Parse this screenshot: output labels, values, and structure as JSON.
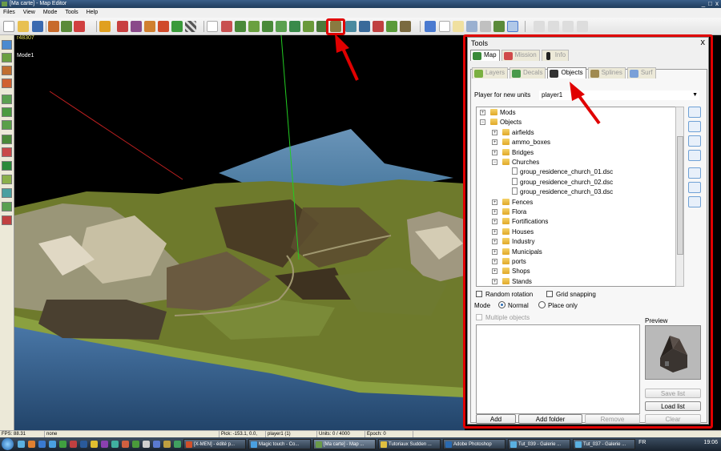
{
  "window": {
    "title": "[Ma carte] - Map Editor",
    "controls": [
      "_",
      "□",
      "x"
    ]
  },
  "menu": [
    "Files",
    "View",
    "Mode",
    "Tools",
    "Help"
  ],
  "viewport": {
    "label_top": "r48307",
    "label_mode": "Mode1"
  },
  "tools_panel": {
    "title": "Tools",
    "close": "x",
    "tabs_top": [
      {
        "label": "Map",
        "active": true,
        "icon": "map-icon"
      },
      {
        "label": "Mission",
        "active": false,
        "icon": "mission-icon"
      },
      {
        "label": "Info",
        "active": false,
        "icon": "info-icon"
      }
    ],
    "tabs_sub": [
      {
        "label": "Layers",
        "active": false,
        "icon": "layers-icon"
      },
      {
        "label": "Decals",
        "active": false,
        "icon": "decals-icon"
      },
      {
        "label": "Objects",
        "active": true,
        "icon": "objects-icon"
      },
      {
        "label": "Splines",
        "active": false,
        "icon": "splines-icon"
      },
      {
        "label": "Surf",
        "active": false,
        "icon": "surf-icon"
      }
    ],
    "player_label": "Player for new units",
    "player_value": "player1",
    "tree": [
      {
        "label": "Mods",
        "level": 0,
        "type": "folder",
        "expanded": false
      },
      {
        "label": "Objects",
        "level": 0,
        "type": "folder",
        "expanded": true
      },
      {
        "label": "airfields",
        "level": 1,
        "type": "folder",
        "expanded": false
      },
      {
        "label": "ammo_boxes",
        "level": 1,
        "type": "folder",
        "expanded": false
      },
      {
        "label": "Bridges",
        "level": 1,
        "type": "folder",
        "expanded": false
      },
      {
        "label": "Churches",
        "level": 1,
        "type": "folder",
        "expanded": true
      },
      {
        "label": "group_residence_church_01.dsc",
        "level": 2,
        "type": "file"
      },
      {
        "label": "group_residence_church_02.dsc",
        "level": 2,
        "type": "file"
      },
      {
        "label": "group_residence_church_03.dsc",
        "level": 2,
        "type": "file"
      },
      {
        "label": "Fences",
        "level": 1,
        "type": "folder",
        "expanded": false
      },
      {
        "label": "Flora",
        "level": 1,
        "type": "folder",
        "expanded": false
      },
      {
        "label": "Fortifications",
        "level": 1,
        "type": "folder",
        "expanded": false
      },
      {
        "label": "Houses",
        "level": 1,
        "type": "folder",
        "expanded": false
      },
      {
        "label": "Industry",
        "level": 1,
        "type": "folder",
        "expanded": false
      },
      {
        "label": "Municipals",
        "level": 1,
        "type": "folder",
        "expanded": false
      },
      {
        "label": "ports",
        "level": 1,
        "type": "folder",
        "expanded": false
      },
      {
        "label": "Shops",
        "level": 1,
        "type": "folder",
        "expanded": false
      },
      {
        "label": "Stands",
        "level": 1,
        "type": "folder",
        "expanded": false
      }
    ],
    "random_rotation": "Random rotation",
    "grid_snapping": "Grid snapping",
    "mode_label": "Mode",
    "mode_normal": "Normal",
    "mode_place_only": "Place only",
    "multiple_objects": "Multiple objects",
    "preview_label": "Preview",
    "buttons": {
      "save_list": "Save list",
      "load_list": "Load list",
      "clear": "Clear",
      "add": "Add",
      "add_folder": "Add folder",
      "remove": "Remove"
    }
  },
  "status": {
    "fps": "FPS: 88.31",
    "field2": "none",
    "pick": "Pick: -153.1, 0.0, 86.9",
    "player": "player1 (1)",
    "units": "Units: 0 / 4000",
    "epoch": "Epoch: 0"
  },
  "taskbar": {
    "tasks": [
      {
        "label": "[X-MEN] - édité p...",
        "color": "#d0502a"
      },
      {
        "label": "Magic touch - Co...",
        "color": "#4aa0e0"
      },
      {
        "label": "[Ma carte] - Map ...",
        "color": "#6a9a4a"
      },
      {
        "label": "Tutoriaux Sudden ...",
        "color": "#e0c040"
      },
      {
        "label": "Adobe Photoshop",
        "color": "#2a6ab0"
      },
      {
        "label": "Tut_039 - Galerie ...",
        "color": "#5ab0e0"
      },
      {
        "label": "Tut_037 - Galerie ...",
        "color": "#5ab0e0"
      }
    ],
    "lang": "FR",
    "clock": "19:06"
  },
  "colors": {
    "accent_red": "#e00000",
    "sky": "#000000",
    "grass": "#7a8a30"
  }
}
